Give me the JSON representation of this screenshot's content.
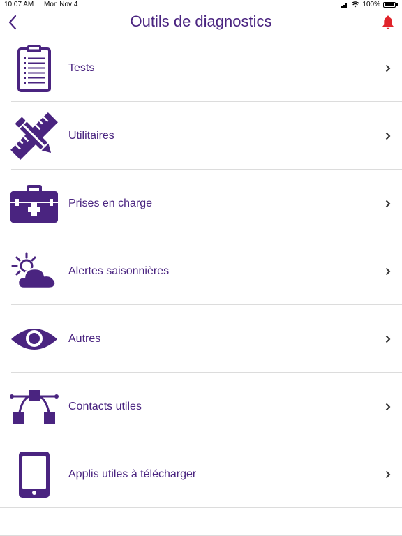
{
  "status_bar": {
    "time": "10:07 AM",
    "date": "Mon Nov 4",
    "battery": "100%"
  },
  "header": {
    "title": "Outils de diagnostics",
    "back_icon": "chevron-left-icon",
    "bell_icon": "bell-icon"
  },
  "colors": {
    "primary": "#4a2480",
    "bell": "#e0242b",
    "divider": "#dcdcdc"
  },
  "menu": {
    "items": [
      {
        "label": "Tests",
        "icon": "clipboard-icon"
      },
      {
        "label": "Utilitaires",
        "icon": "pencil-ruler-icon"
      },
      {
        "label": "Prises en charge",
        "icon": "medical-kit-icon"
      },
      {
        "label": "Alertes saisonnières",
        "icon": "sun-cloud-icon"
      },
      {
        "label": "Autres",
        "icon": "eye-icon"
      },
      {
        "label": "Contacts utiles",
        "icon": "vector-path-icon"
      },
      {
        "label": "Applis utiles à télécharger",
        "icon": "tablet-icon"
      }
    ]
  }
}
